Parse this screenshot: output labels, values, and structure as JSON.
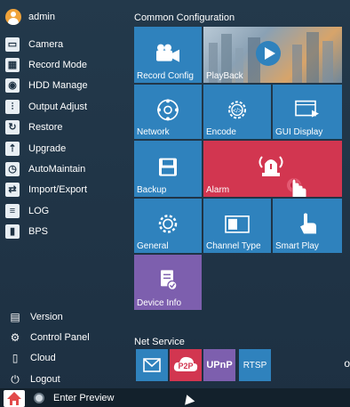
{
  "user": {
    "name": "admin"
  },
  "sidebar": {
    "items": [
      {
        "label": "Camera",
        "icon": "camera-icon"
      },
      {
        "label": "Record Mode",
        "icon": "record-mode-icon"
      },
      {
        "label": "HDD Manage",
        "icon": "hdd-icon"
      },
      {
        "label": "Output Adjust",
        "icon": "output-adjust-icon"
      },
      {
        "label": "Restore",
        "icon": "restore-icon"
      },
      {
        "label": "Upgrade",
        "icon": "upgrade-icon"
      },
      {
        "label": "AutoMaintain",
        "icon": "automaintain-icon"
      },
      {
        "label": "Import/Export",
        "icon": "import-export-icon"
      },
      {
        "label": "LOG",
        "icon": "log-icon"
      },
      {
        "label": "BPS",
        "icon": "bps-icon"
      }
    ],
    "bottom": [
      {
        "label": "Version",
        "icon": "version-icon"
      },
      {
        "label": "Control Panel",
        "icon": "control-panel-icon"
      },
      {
        "label": "Cloud",
        "icon": "cloud-icon"
      },
      {
        "label": "Logout",
        "icon": "power-icon"
      }
    ]
  },
  "config": {
    "title": "Common Configuration",
    "tiles": {
      "record_config": "Record Config",
      "playback": "PlayBack",
      "network": "Network",
      "encode": "Encode",
      "gui_display": "GUI Display",
      "backup": "Backup",
      "alarm": "Alarm",
      "general": "General",
      "channel_type": "Channel Type",
      "smart_play": "Smart Play",
      "device_info": "Device Info"
    }
  },
  "net_service": {
    "title": "Net Service",
    "items": [
      {
        "label": "",
        "icon": "email-icon"
      },
      {
        "label": "P2P",
        "icon": "p2p-cloud-icon"
      },
      {
        "label": "UPnP",
        "icon": "upnp-icon"
      },
      {
        "label": "RTSP",
        "icon": "rtsp-icon"
      }
    ]
  },
  "taskbar": {
    "preview_label": "Enter Preview"
  },
  "colors": {
    "tile_blue": "#2f82bd",
    "tile_red": "#d23650",
    "tile_purple": "#7d5fae",
    "background": "#1f3344"
  }
}
